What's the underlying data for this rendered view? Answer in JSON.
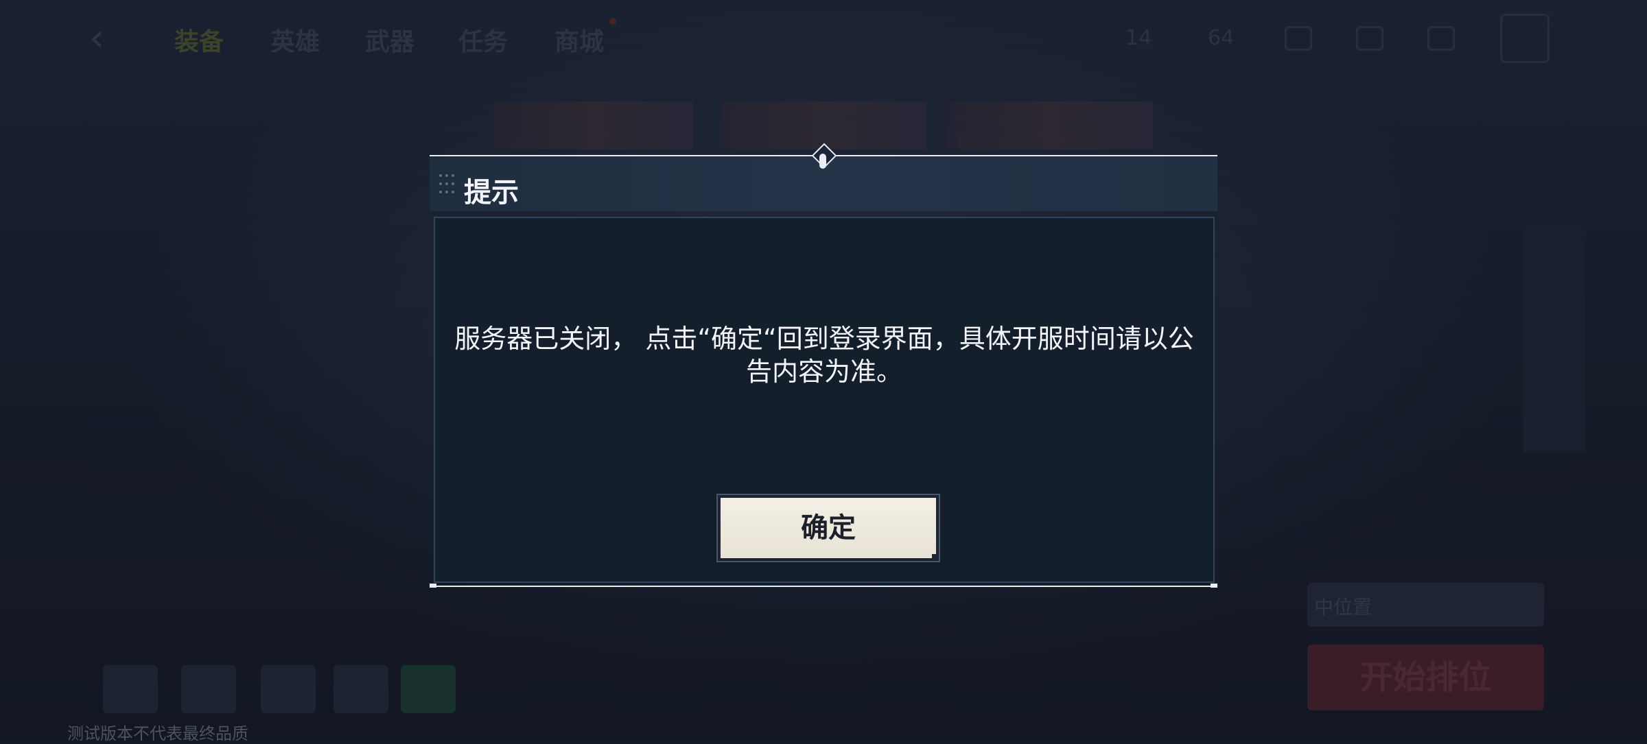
{
  "background": {
    "nav_tabs": [
      {
        "label": "装备"
      },
      {
        "label": "英雄"
      },
      {
        "label": "武器"
      },
      {
        "label": "任务"
      },
      {
        "label": "商城"
      }
    ],
    "resources": [
      "14",
      "64"
    ],
    "mode_label": "中位置",
    "start_button": "开始排位",
    "watermark": "测试版本不代表最终品质"
  },
  "modal": {
    "title": "提示",
    "message": "服务器已关闭， 点击“确定“回到登录界面，具体开服时间请以公告内容为准。",
    "confirm_label": "确定"
  },
  "colors": {
    "modal_header_bg": "#26344a",
    "modal_body_bg": "#141e2b",
    "confirm_bg": "#f3efe4",
    "start_button_bg": "#3a1d28"
  }
}
